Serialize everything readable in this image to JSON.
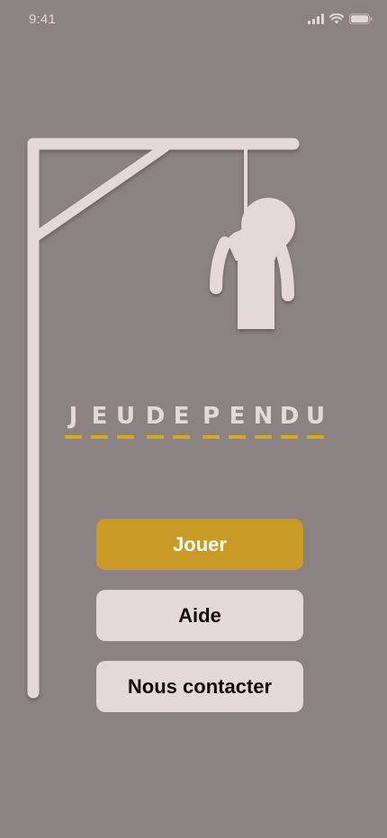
{
  "status_bar": {
    "time": "9:41",
    "icons": [
      "signal-icon",
      "wifi-icon",
      "battery-icon"
    ]
  },
  "colors": {
    "background": "#8b8382",
    "gallows": "#e4d8d8",
    "accent": "#c99a25",
    "button_secondary": "#e4d8d8"
  },
  "title": {
    "words": [
      [
        "J",
        "E",
        "U"
      ],
      [
        "D",
        "E"
      ],
      [
        "P",
        "E",
        "N",
        "D",
        "U"
      ]
    ]
  },
  "buttons": {
    "play": "Jouer",
    "help": "Aide",
    "contact": "Nous contacter"
  }
}
